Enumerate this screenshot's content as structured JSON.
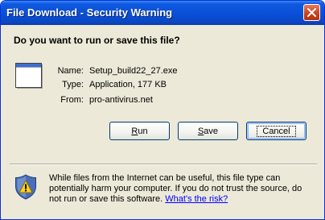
{
  "window": {
    "title": "File Download - Security Warning"
  },
  "prompt": {
    "question": "Do you want to run or save this file?"
  },
  "file_info": {
    "icon": "application-window-icon",
    "rows": [
      {
        "label": "Name:",
        "value": "Setup_build22_27.exe"
      },
      {
        "label": "Type:",
        "value": "Application, 177 KB"
      },
      {
        "label": "From:",
        "value": "pro-antivirus.net"
      }
    ]
  },
  "buttons": {
    "run": {
      "accel": "R",
      "rest": "un"
    },
    "save": {
      "accel": "S",
      "rest": "ave"
    },
    "cancel": {
      "label": "Cancel"
    }
  },
  "warning": {
    "icon": "security-shield-icon",
    "text": "While files from the Internet can be useful, this file type can potentially harm your computer. If you do not trust the source, do not run or save this software. ",
    "link": "What's the risk?"
  },
  "colors": {
    "titlebar": "#0a4fd6",
    "dialog_bg": "#ece9d8",
    "close_button": "#c8401c",
    "link": "#0000ff",
    "button_border": "#003c74"
  }
}
